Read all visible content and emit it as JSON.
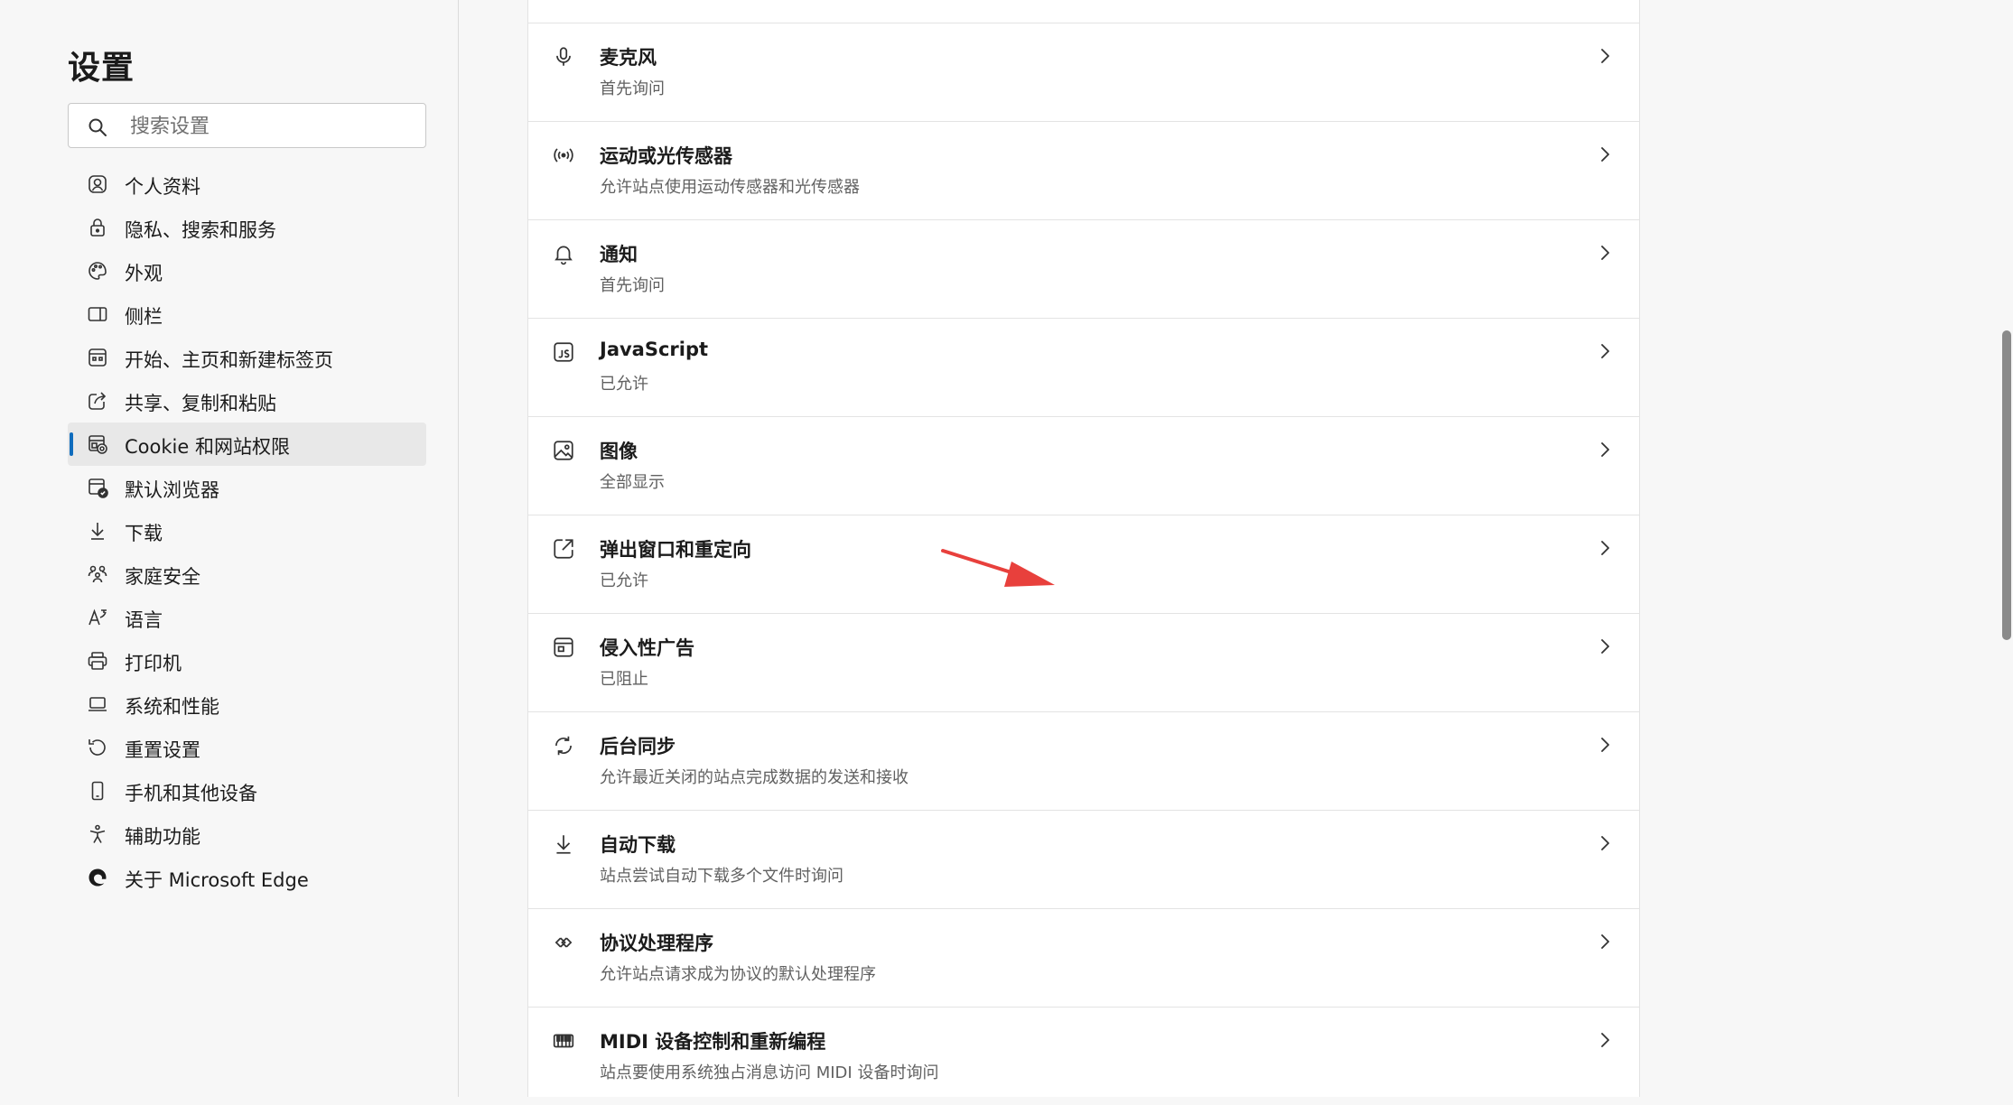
{
  "sidebar": {
    "title": "设置",
    "search": {
      "placeholder": "搜索设置",
      "value": ""
    },
    "items": [
      {
        "label": "个人资料",
        "icon": "profile-icon",
        "active": false
      },
      {
        "label": "隐私、搜索和服务",
        "icon": "lock-icon",
        "active": false
      },
      {
        "label": "外观",
        "icon": "palette-icon",
        "active": false
      },
      {
        "label": "侧栏",
        "icon": "sidebar-icon",
        "active": false
      },
      {
        "label": "开始、主页和新建标签页",
        "icon": "home-tabs-icon",
        "active": false
      },
      {
        "label": "共享、复制和粘贴",
        "icon": "share-icon",
        "active": false
      },
      {
        "label": "Cookie 和网站权限",
        "icon": "cookie-icon",
        "active": true
      },
      {
        "label": "默认浏览器",
        "icon": "browser-icon",
        "active": false
      },
      {
        "label": "下载",
        "icon": "download-icon",
        "active": false
      },
      {
        "label": "家庭安全",
        "icon": "family-icon",
        "active": false
      },
      {
        "label": "语言",
        "icon": "language-icon",
        "active": false
      },
      {
        "label": "打印机",
        "icon": "printer-icon",
        "active": false
      },
      {
        "label": "系统和性能",
        "icon": "laptop-icon",
        "active": false
      },
      {
        "label": "重置设置",
        "icon": "reset-icon",
        "active": false
      },
      {
        "label": "手机和其他设备",
        "icon": "phone-icon",
        "active": false
      },
      {
        "label": "辅助功能",
        "icon": "accessibility-icon",
        "active": false
      },
      {
        "label": "关于 Microsoft Edge",
        "icon": "edge-logo-icon",
        "active": false
      }
    ]
  },
  "permissions": [
    {
      "title": "麦克风",
      "subtitle": "首先询问",
      "icon": "microphone-icon"
    },
    {
      "title": "运动或光传感器",
      "subtitle": "允许站点使用运动传感器和光传感器",
      "icon": "sensor-icon"
    },
    {
      "title": "通知",
      "subtitle": "首先询问",
      "icon": "bell-icon"
    },
    {
      "title": "JavaScript",
      "subtitle": "已允许",
      "icon": "javascript-icon"
    },
    {
      "title": "图像",
      "subtitle": "全部显示",
      "icon": "image-icon"
    },
    {
      "title": "弹出窗口和重定向",
      "subtitle": "已允许",
      "icon": "popup-icon"
    },
    {
      "title": "侵入性广告",
      "subtitle": "已阻止",
      "icon": "ads-icon"
    },
    {
      "title": "后台同步",
      "subtitle": "允许最近关闭的站点完成数据的发送和接收",
      "icon": "sync-icon"
    },
    {
      "title": "自动下载",
      "subtitle": "站点尝试自动下载多个文件时询问",
      "icon": "download-icon"
    },
    {
      "title": "协议处理程序",
      "subtitle": "允许站点请求成为协议的默认处理程序",
      "icon": "protocol-icon"
    },
    {
      "title": "MIDI 设备控制和重新编程",
      "subtitle": "站点要使用系统独占消息访问 MIDI 设备时询问",
      "icon": "midi-icon"
    }
  ],
  "colors": {
    "accent": "#0f6cbd",
    "annotation_arrow": "#e8403c",
    "active_item_bg": "#e8e8e8"
  }
}
